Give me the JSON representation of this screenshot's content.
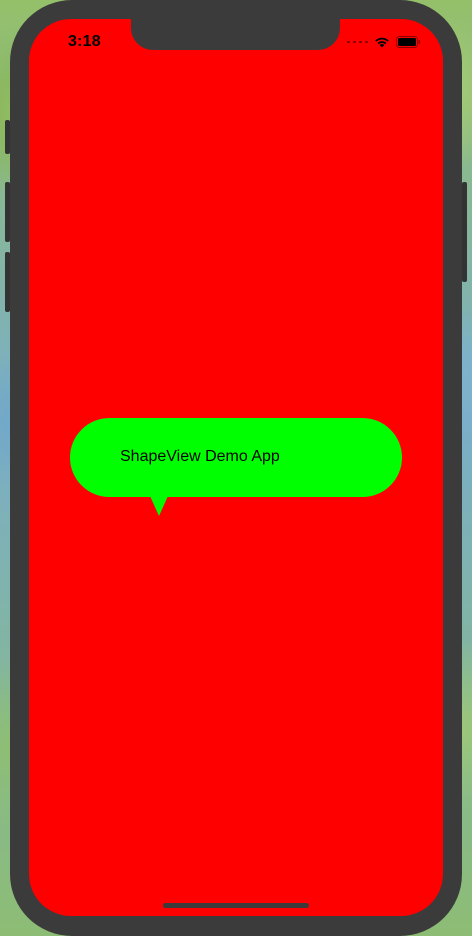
{
  "status_bar": {
    "time": "3:18",
    "signal_icon": "signal-dots-icon",
    "wifi_icon": "wifi-icon",
    "battery_icon": "battery-icon"
  },
  "main": {
    "background_color": "#ff0000",
    "bubble": {
      "text": "ShapeView Demo App",
      "color": "#00ff00"
    }
  }
}
